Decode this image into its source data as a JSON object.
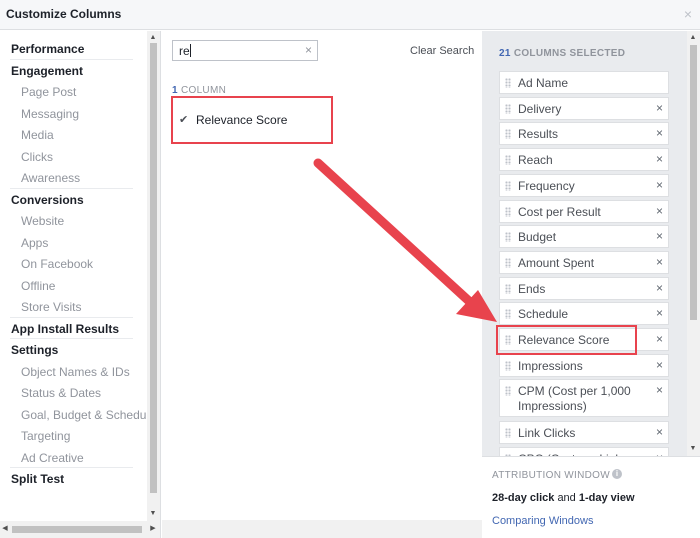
{
  "dialog": {
    "title": "Customize Columns",
    "close_glyph": "×"
  },
  "sidebar": {
    "groups": [
      {
        "label": "Performance",
        "items": []
      },
      {
        "label": "Engagement",
        "items": [
          "Page Post",
          "Messaging",
          "Media",
          "Clicks",
          "Awareness"
        ]
      },
      {
        "label": "Conversions",
        "items": [
          "Website",
          "Apps",
          "On Facebook",
          "Offline",
          "Store Visits"
        ]
      },
      {
        "label": "App Install Results",
        "items": []
      },
      {
        "label": "Settings",
        "items": [
          "Object Names & IDs",
          "Status & Dates",
          "Goal, Budget & Schedule",
          "Targeting",
          "Ad Creative"
        ]
      },
      {
        "label": "Split Test",
        "items": []
      }
    ]
  },
  "search": {
    "value": "re",
    "clear_glyph": "×",
    "clear_label": "Clear Search"
  },
  "results": {
    "count_number": "1",
    "count_label": "COLUMN",
    "items": [
      {
        "label": "Relevance Score",
        "checked": true,
        "check_glyph": "✔"
      }
    ]
  },
  "selected": {
    "count_number": "21",
    "count_label": "COLUMNS SELECTED",
    "remove_glyph": "×",
    "items": [
      {
        "label": "Ad Name",
        "removable": false
      },
      {
        "label": "Delivery",
        "removable": true
      },
      {
        "label": "Results",
        "removable": true
      },
      {
        "label": "Reach",
        "removable": true
      },
      {
        "label": "Frequency",
        "removable": true
      },
      {
        "label": "Cost per Result",
        "removable": true
      },
      {
        "label": "Budget",
        "removable": true
      },
      {
        "label": "Amount Spent",
        "removable": true
      },
      {
        "label": "Ends",
        "removable": true
      },
      {
        "label": "Schedule",
        "removable": true
      },
      {
        "label": "Relevance Score",
        "removable": true
      },
      {
        "label": "Impressions",
        "removable": true
      },
      {
        "label": "CPM (Cost per 1,000 Impressions)",
        "removable": true
      },
      {
        "label": "Link Clicks",
        "removable": true
      },
      {
        "label": "CPC (Cost per Link Click)",
        "removable": true
      }
    ]
  },
  "attribution": {
    "heading": "ATTRIBUTION WINDOW",
    "info_glyph": "i",
    "click_window": "28-day click",
    "joiner": "and",
    "view_window": "1-day view",
    "link": "Comparing Windows"
  },
  "colors": {
    "accent": "#4267b2",
    "highlight": "#e8434d"
  }
}
